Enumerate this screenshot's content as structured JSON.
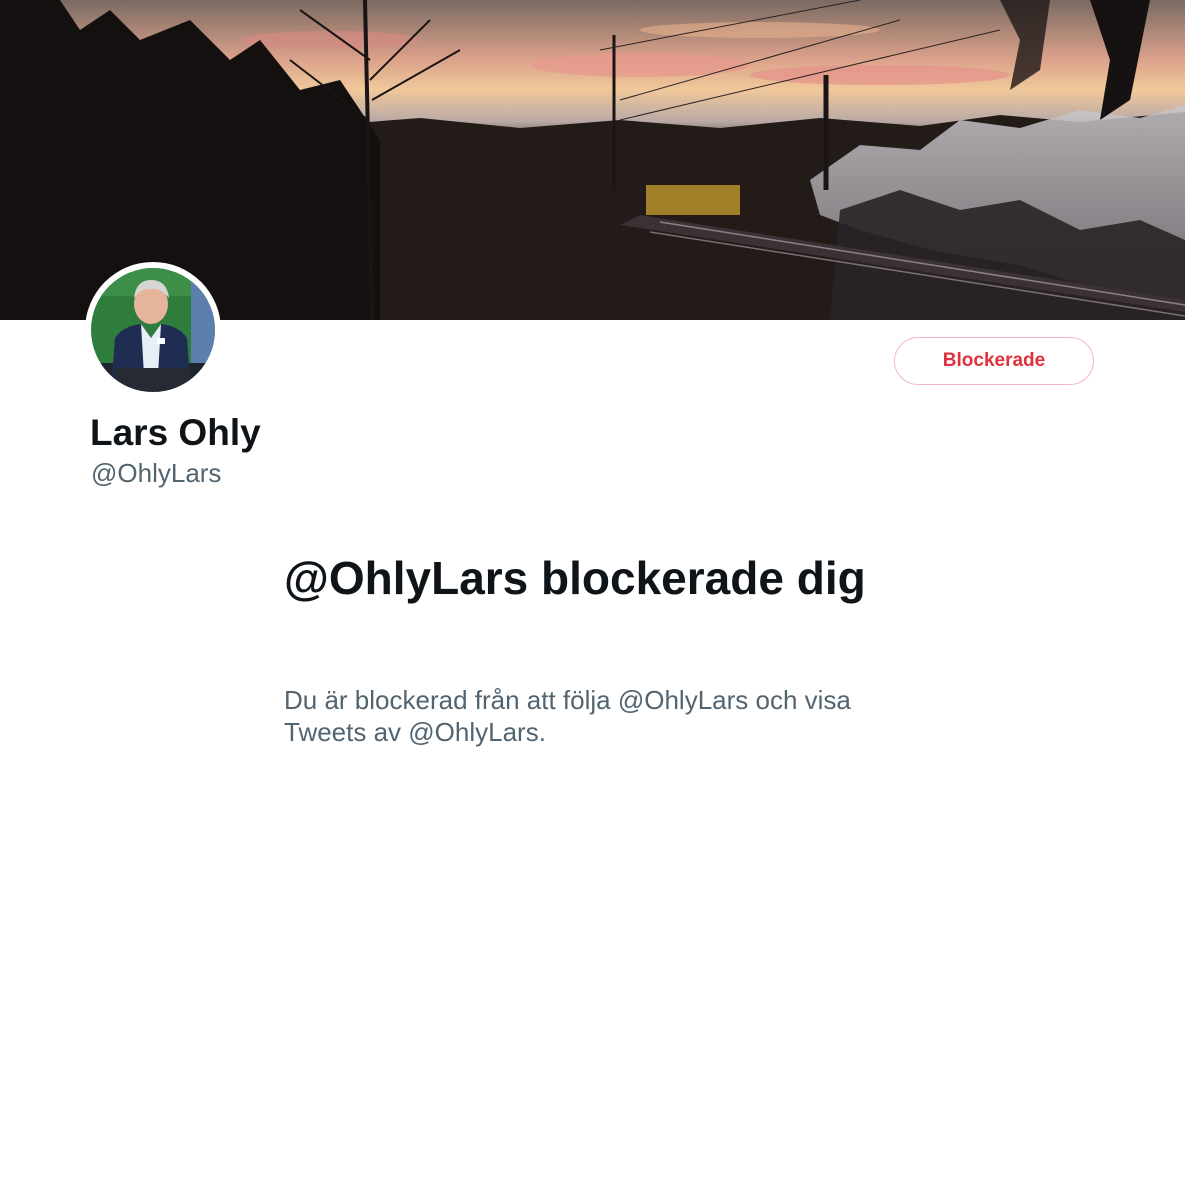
{
  "profile": {
    "display_name": "Lars Ohly",
    "handle": "@OhlyLars",
    "banner_image": "sunset-railway-winter-photo",
    "avatar_image": "speaker-at-podium-photo"
  },
  "actions": {
    "blocked_label": "Blockerade"
  },
  "block_notice": {
    "title": "@OhlyLars blockerade dig",
    "description": "Du är blockerad från att följa @OhlyLars och visa Tweets av @OhlyLars."
  },
  "colors": {
    "text_primary": "#0f1419",
    "text_secondary": "#536471",
    "blocked_red": "#e0313e",
    "blocked_border": "#f4b8bf"
  }
}
